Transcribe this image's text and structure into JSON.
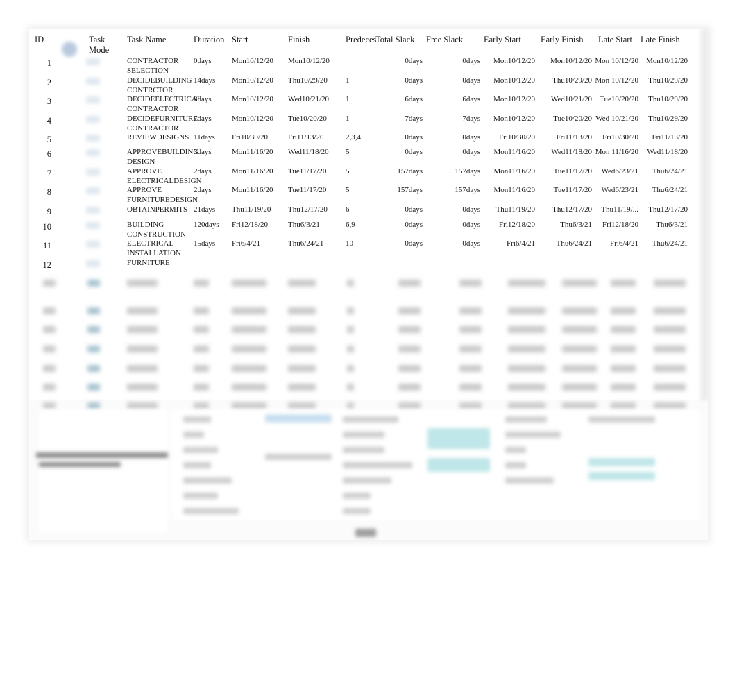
{
  "table": {
    "headers": {
      "id": "ID",
      "task_mode": "Task Mode",
      "task_name": "Task Name",
      "duration": "Duration",
      "start": "Start",
      "finish": "Finish",
      "predecessors": "Predeces",
      "total_slack": "Total Slack",
      "free_slack": "Free Slack",
      "early_start": "Early Start",
      "early_finish": "Early Finish",
      "late_start": "Late Start",
      "late_finish": "Late Finish"
    },
    "header_icon": "task-mode-indicator-icon",
    "rows": [
      {
        "id": "1",
        "name": "CONTRACTOR SELECTION",
        "duration": "0days",
        "start": "Mon10/12/20",
        "finish": "Mon10/12/20",
        "pred": "",
        "total_slack": "0days",
        "free_slack": "0days",
        "early_start": "Mon10/12/20",
        "early_finish": "Mon10/12/20",
        "late_start": "Mon 10/12/20",
        "late_finish": "Mon10/12/20"
      },
      {
        "id": "2",
        "name": "DECIDEBUILDING CONTRCTOR",
        "duration": "14days",
        "start": "Mon10/12/20",
        "finish": "Thu10/29/20",
        "pred": "1",
        "total_slack": "0days",
        "free_slack": "0days",
        "early_start": "Mon10/12/20",
        "early_finish": "Thu10/29/20",
        "late_start": "Mon 10/12/20",
        "late_finish": "Thu10/29/20"
      },
      {
        "id": "3",
        "name": "DECIDEELECTRICAL CONTRACTOR",
        "duration": "8days",
        "start": "Mon10/12/20",
        "finish": "Wed10/21/20",
        "pred": "1",
        "total_slack": "6days",
        "free_slack": "6days",
        "early_start": "Mon10/12/20",
        "early_finish": "Wed10/21/20",
        "late_start": "Tue10/20/20",
        "late_finish": "Thu10/29/20"
      },
      {
        "id": "4",
        "name": "DECIDEFURNITURE CONTRACTOR",
        "duration": "7days",
        "start": "Mon10/12/20",
        "finish": "Tue10/20/20",
        "pred": "1",
        "total_slack": "7days",
        "free_slack": "7days",
        "early_start": "Mon10/12/20",
        "early_finish": "Tue10/20/20",
        "late_start": "Wed 10/21/20",
        "late_finish": "Thu10/29/20"
      },
      {
        "id": "5",
        "name": "REVIEWDESIGNS",
        "duration": "11days",
        "start": "Fri10/30/20",
        "finish": "Fri11/13/20",
        "pred": "2,3,4",
        "total_slack": "0days",
        "free_slack": "0days",
        "early_start": "Fri10/30/20",
        "early_finish": "Fri11/13/20",
        "late_start": "Fri10/30/20",
        "late_finish": "Fri11/13/20"
      },
      {
        "id": "6",
        "name": "APPROVEBUILDING DESIGN",
        "duration": "3days",
        "start": "Mon11/16/20",
        "finish": "Wed11/18/20",
        "pred": "5",
        "total_slack": "0days",
        "free_slack": "0days",
        "early_start": "Mon11/16/20",
        "early_finish": "Wed11/18/20",
        "late_start": "Mon 11/16/20",
        "late_finish": "Wed11/18/20"
      },
      {
        "id": "7",
        "name": "APPROVE ELECTRICALDESIGN",
        "duration": "2days",
        "start": "Mon11/16/20",
        "finish": "Tue11/17/20",
        "pred": "5",
        "total_slack": "157days",
        "free_slack": "157days",
        "early_start": "Mon11/16/20",
        "early_finish": "Tue11/17/20",
        "late_start": "Wed6/23/21",
        "late_finish": "Thu6/24/21"
      },
      {
        "id": "8",
        "name": "APPROVE FURNITUREDESIGN",
        "duration": "2days",
        "start": "Mon11/16/20",
        "finish": "Tue11/17/20",
        "pred": "5",
        "total_slack": "157days",
        "free_slack": "157days",
        "early_start": "Mon11/16/20",
        "early_finish": "Tue11/17/20",
        "late_start": "Wed6/23/21",
        "late_finish": "Thu6/24/21"
      },
      {
        "id": "9",
        "name": "OBTAINPERMITS",
        "duration": "21days",
        "start": "Thu11/19/20",
        "finish": "Thu12/17/20",
        "pred": "6",
        "total_slack": "0days",
        "free_slack": "0days",
        "early_start": "Thu11/19/20",
        "early_finish": "Thu12/17/20",
        "late_start": "Thu11/19/...",
        "late_finish": "Thu12/17/20"
      },
      {
        "id": "10",
        "name": "BUILDING CONSTRUCTION",
        "duration": "120days",
        "start": "Fri12/18/20",
        "finish": "Thu6/3/21",
        "pred": "6,9",
        "total_slack": "0days",
        "free_slack": "0days",
        "early_start": "Fri12/18/20",
        "early_finish": "Thu6/3/21",
        "late_start": "Fri12/18/20",
        "late_finish": "Thu6/3/21"
      },
      {
        "id": "11",
        "name": "ELECTRICAL INSTALLATION",
        "duration": "15days",
        "start": "Fri6/4/21",
        "finish": "Thu6/24/21",
        "pred": "10",
        "total_slack": "0days",
        "free_slack": "0days",
        "early_start": "Fri6/4/21",
        "early_finish": "Thu6/24/21",
        "late_start": "Fri6/4/21",
        "late_finish": "Thu6/24/21"
      },
      {
        "id": "12",
        "name": "FURNITURE",
        "duration": "",
        "start": "",
        "finish": "",
        "pred": "",
        "total_slack": "",
        "free_slack": "",
        "early_start": "",
        "early_finish": "",
        "late_start": "",
        "late_finish": ""
      }
    ],
    "blurred_row_count": 7
  }
}
